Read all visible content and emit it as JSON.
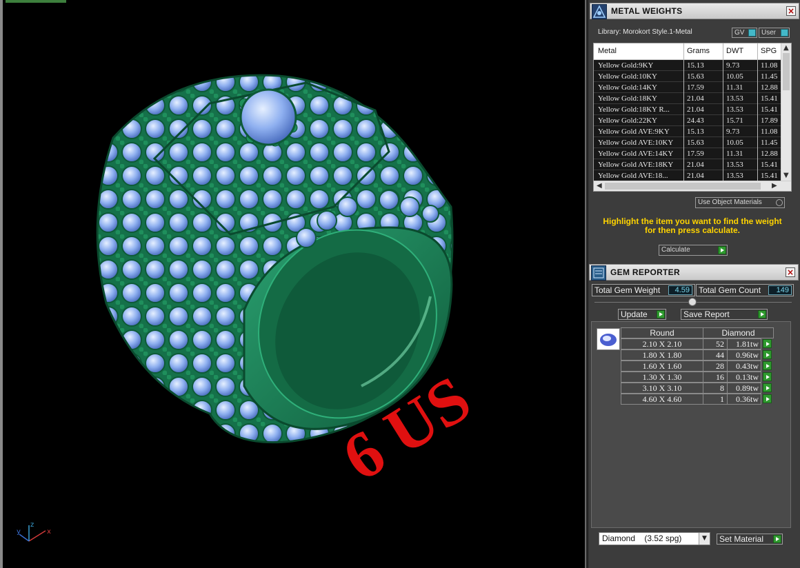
{
  "viewport": {
    "size_label": "6 US",
    "axes": {
      "x": "x",
      "y": "y",
      "z": "z"
    }
  },
  "metal_weights": {
    "title": "METAL WEIGHTS",
    "library_label": "Library: Morokort Style.1-Metal",
    "gv_label": "GV",
    "user_label": "User",
    "columns": [
      "Metal",
      "Grams",
      "DWT",
      "SPG"
    ],
    "rows": [
      [
        "Yellow Gold:9KY",
        "15.13",
        "9.73",
        "11.08"
      ],
      [
        "Yellow Gold:10KY",
        "15.63",
        "10.05",
        "11.45"
      ],
      [
        "Yellow Gold:14KY",
        "17.59",
        "11.31",
        "12.88"
      ],
      [
        "Yellow Gold:18KY",
        "21.04",
        "13.53",
        "15.41"
      ],
      [
        "Yellow Gold:18KY R...",
        "21.04",
        "13.53",
        "15.41"
      ],
      [
        "Yellow Gold:22KY",
        "24.43",
        "15.71",
        "17.89"
      ],
      [
        "Yellow Gold AVE:9KY",
        "15.13",
        "9.73",
        "11.08"
      ],
      [
        "Yellow Gold AVE:10KY",
        "15.63",
        "10.05",
        "11.45"
      ],
      [
        "Yellow Gold AVE:14KY",
        "17.59",
        "11.31",
        "12.88"
      ],
      [
        "Yellow Gold AVE:18KY",
        "21.04",
        "13.53",
        "15.41"
      ],
      [
        "Yellow Gold AVE:18...",
        "21.04",
        "13.53",
        "15.41"
      ]
    ],
    "use_object_materials": "Use Object Materials",
    "instruction_line1": "Highlight the item you want to find the weight",
    "instruction_line2": "for then press calculate.",
    "calculate_label": "Calculate"
  },
  "gem_reporter": {
    "title": "GEM REPORTER",
    "total_weight_label": "Total Gem Weight",
    "total_weight_value": "4.59",
    "total_count_label": "Total Gem Count",
    "total_count_value": "149",
    "update_label": "Update",
    "save_report_label": "Save Report",
    "col_shape": "Round",
    "col_material": "Diamond",
    "rows": [
      {
        "size": "2.10 X 2.10",
        "count": "52",
        "weight": "1.81tw"
      },
      {
        "size": "1.80 X 1.80",
        "count": "44",
        "weight": "0.96tw"
      },
      {
        "size": "1.60 X 1.60",
        "count": "28",
        "weight": "0.43tw"
      },
      {
        "size": "1.30 X 1.30",
        "count": "16",
        "weight": "0.13tw"
      },
      {
        "size": "3.10 X 3.10",
        "count": "8",
        "weight": "0.89tw"
      },
      {
        "size": "4.60 X 4.60",
        "count": "1",
        "weight": "0.36tw"
      }
    ],
    "material_select": "Diamond    (3.52 spg)",
    "set_material_label": "Set Material"
  },
  "colors": {
    "metal": "#1e8a5e",
    "gem": "#8fb0f0",
    "label_red": "#e01010",
    "instruction": "#ffd400"
  }
}
